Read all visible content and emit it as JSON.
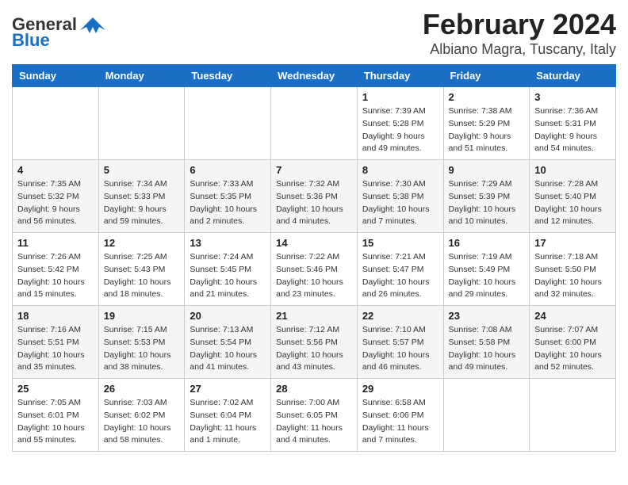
{
  "header": {
    "logo_general": "General",
    "logo_blue": "Blue",
    "title": "February 2024",
    "subtitle": "Albiano Magra, Tuscany, Italy"
  },
  "weekdays": [
    "Sunday",
    "Monday",
    "Tuesday",
    "Wednesday",
    "Thursday",
    "Friday",
    "Saturday"
  ],
  "weeks": [
    [
      {
        "day": "",
        "info": ""
      },
      {
        "day": "",
        "info": ""
      },
      {
        "day": "",
        "info": ""
      },
      {
        "day": "",
        "info": ""
      },
      {
        "day": "1",
        "info": "Sunrise: 7:39 AM\nSunset: 5:28 PM\nDaylight: 9 hours\nand 49 minutes."
      },
      {
        "day": "2",
        "info": "Sunrise: 7:38 AM\nSunset: 5:29 PM\nDaylight: 9 hours\nand 51 minutes."
      },
      {
        "day": "3",
        "info": "Sunrise: 7:36 AM\nSunset: 5:31 PM\nDaylight: 9 hours\nand 54 minutes."
      }
    ],
    [
      {
        "day": "4",
        "info": "Sunrise: 7:35 AM\nSunset: 5:32 PM\nDaylight: 9 hours\nand 56 minutes."
      },
      {
        "day": "5",
        "info": "Sunrise: 7:34 AM\nSunset: 5:33 PM\nDaylight: 9 hours\nand 59 minutes."
      },
      {
        "day": "6",
        "info": "Sunrise: 7:33 AM\nSunset: 5:35 PM\nDaylight: 10 hours\nand 2 minutes."
      },
      {
        "day": "7",
        "info": "Sunrise: 7:32 AM\nSunset: 5:36 PM\nDaylight: 10 hours\nand 4 minutes."
      },
      {
        "day": "8",
        "info": "Sunrise: 7:30 AM\nSunset: 5:38 PM\nDaylight: 10 hours\nand 7 minutes."
      },
      {
        "day": "9",
        "info": "Sunrise: 7:29 AM\nSunset: 5:39 PM\nDaylight: 10 hours\nand 10 minutes."
      },
      {
        "day": "10",
        "info": "Sunrise: 7:28 AM\nSunset: 5:40 PM\nDaylight: 10 hours\nand 12 minutes."
      }
    ],
    [
      {
        "day": "11",
        "info": "Sunrise: 7:26 AM\nSunset: 5:42 PM\nDaylight: 10 hours\nand 15 minutes."
      },
      {
        "day": "12",
        "info": "Sunrise: 7:25 AM\nSunset: 5:43 PM\nDaylight: 10 hours\nand 18 minutes."
      },
      {
        "day": "13",
        "info": "Sunrise: 7:24 AM\nSunset: 5:45 PM\nDaylight: 10 hours\nand 21 minutes."
      },
      {
        "day": "14",
        "info": "Sunrise: 7:22 AM\nSunset: 5:46 PM\nDaylight: 10 hours\nand 23 minutes."
      },
      {
        "day": "15",
        "info": "Sunrise: 7:21 AM\nSunset: 5:47 PM\nDaylight: 10 hours\nand 26 minutes."
      },
      {
        "day": "16",
        "info": "Sunrise: 7:19 AM\nSunset: 5:49 PM\nDaylight: 10 hours\nand 29 minutes."
      },
      {
        "day": "17",
        "info": "Sunrise: 7:18 AM\nSunset: 5:50 PM\nDaylight: 10 hours\nand 32 minutes."
      }
    ],
    [
      {
        "day": "18",
        "info": "Sunrise: 7:16 AM\nSunset: 5:51 PM\nDaylight: 10 hours\nand 35 minutes."
      },
      {
        "day": "19",
        "info": "Sunrise: 7:15 AM\nSunset: 5:53 PM\nDaylight: 10 hours\nand 38 minutes."
      },
      {
        "day": "20",
        "info": "Sunrise: 7:13 AM\nSunset: 5:54 PM\nDaylight: 10 hours\nand 41 minutes."
      },
      {
        "day": "21",
        "info": "Sunrise: 7:12 AM\nSunset: 5:56 PM\nDaylight: 10 hours\nand 43 minutes."
      },
      {
        "day": "22",
        "info": "Sunrise: 7:10 AM\nSunset: 5:57 PM\nDaylight: 10 hours\nand 46 minutes."
      },
      {
        "day": "23",
        "info": "Sunrise: 7:08 AM\nSunset: 5:58 PM\nDaylight: 10 hours\nand 49 minutes."
      },
      {
        "day": "24",
        "info": "Sunrise: 7:07 AM\nSunset: 6:00 PM\nDaylight: 10 hours\nand 52 minutes."
      }
    ],
    [
      {
        "day": "25",
        "info": "Sunrise: 7:05 AM\nSunset: 6:01 PM\nDaylight: 10 hours\nand 55 minutes."
      },
      {
        "day": "26",
        "info": "Sunrise: 7:03 AM\nSunset: 6:02 PM\nDaylight: 10 hours\nand 58 minutes."
      },
      {
        "day": "27",
        "info": "Sunrise: 7:02 AM\nSunset: 6:04 PM\nDaylight: 11 hours\nand 1 minute."
      },
      {
        "day": "28",
        "info": "Sunrise: 7:00 AM\nSunset: 6:05 PM\nDaylight: 11 hours\nand 4 minutes."
      },
      {
        "day": "29",
        "info": "Sunrise: 6:58 AM\nSunset: 6:06 PM\nDaylight: 11 hours\nand 7 minutes."
      },
      {
        "day": "",
        "info": ""
      },
      {
        "day": "",
        "info": ""
      }
    ]
  ]
}
